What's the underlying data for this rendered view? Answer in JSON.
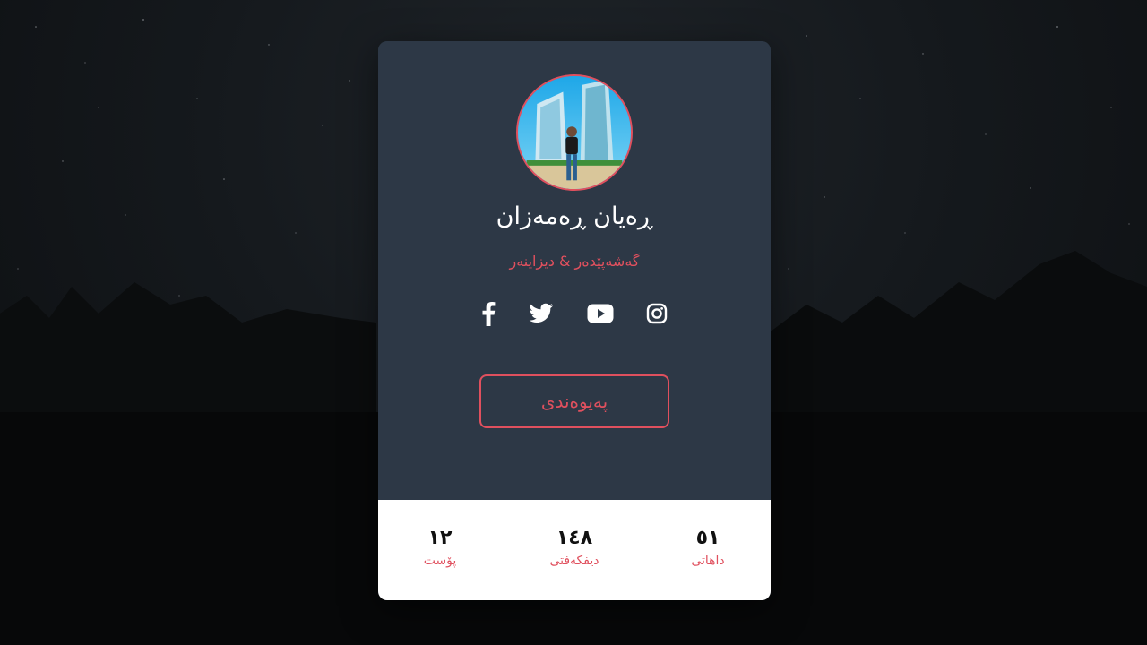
{
  "profile": {
    "name": "ڕەیان ڕەمەزان",
    "title": "گەشەپێدەر & دیزاینەر",
    "contact_label": "پەیوەندی"
  },
  "socials": [
    {
      "icon": "facebook-icon"
    },
    {
      "icon": "twitter-icon"
    },
    {
      "icon": "youtube-icon"
    },
    {
      "icon": "instagram-icon"
    }
  ],
  "stats": [
    {
      "value": "١٢",
      "label": "پۆست"
    },
    {
      "value": "١٤٨",
      "label": "دیفکەفتی"
    },
    {
      "value": "٥١",
      "label": "داهاتی"
    }
  ],
  "colors": {
    "accent": "#e0505e",
    "card": "#2d3846",
    "stats_bg": "#ffffff"
  }
}
